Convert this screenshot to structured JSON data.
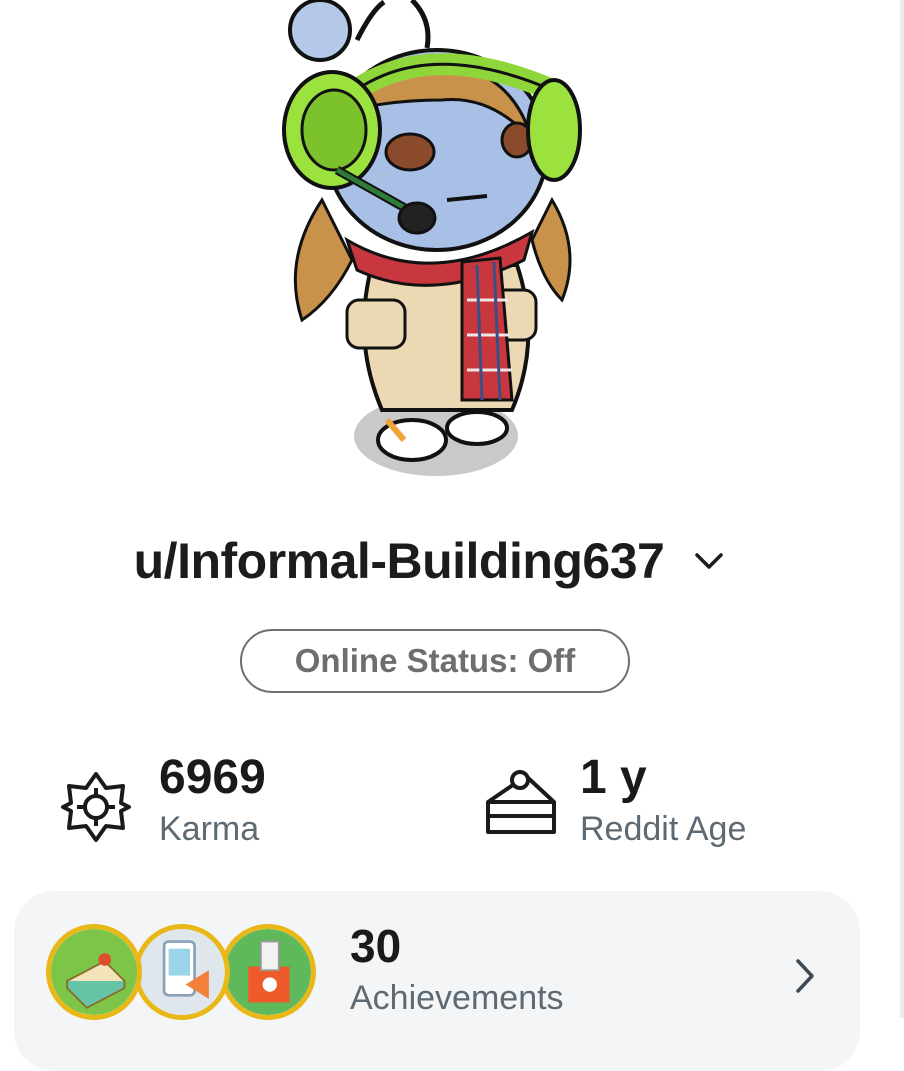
{
  "profile": {
    "username": "u/Informal-Building637",
    "online_status": "Online Status: Off",
    "avatar_icon": "snoo-avatar"
  },
  "stats": {
    "karma": {
      "value": "6969",
      "label": "Karma",
      "icon": "karma-flower-icon"
    },
    "reddit_age": {
      "value": "1 y",
      "label": "Reddit Age",
      "icon": "cake-icon"
    }
  },
  "achievements": {
    "count": "30",
    "label": "Achievements",
    "badges": [
      "cake-badge-icon",
      "upload-badge-icon",
      "gift-badge-icon"
    ]
  },
  "colors": {
    "text_primary": "#1a1a1b",
    "text_secondary": "#5e6a73",
    "pill_border": "#6f6f6f",
    "card_bg": "#f4f5f7",
    "badge_ring": "#e8b818"
  }
}
